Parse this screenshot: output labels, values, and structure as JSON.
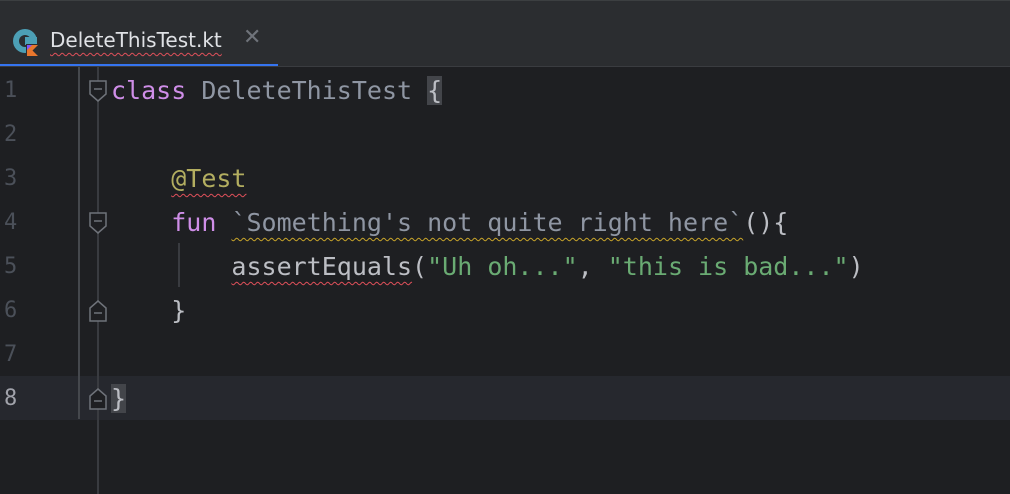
{
  "tab": {
    "title": "DeleteThisTest.kt",
    "close_glyph": "✕",
    "icon": "kotlin-class-file-icon",
    "accent": "#3574f0"
  },
  "editor": {
    "lines": [
      {
        "number": "1",
        "parts": [
          {
            "t": "class",
            "c": "kw"
          },
          {
            "t": " ",
            "c": "txt"
          },
          {
            "t": "DeleteThisTest",
            "c": "cls"
          },
          {
            "t": " ",
            "c": "txt"
          },
          {
            "t": "{",
            "c": "txt brace-hl"
          }
        ],
        "fold": "open"
      },
      {
        "number": "2",
        "parts": []
      },
      {
        "number": "3",
        "parts": [
          {
            "t": "    ",
            "c": "txt"
          },
          {
            "t": "@Test",
            "c": "ann squig-red"
          }
        ]
      },
      {
        "number": "4",
        "parts": [
          {
            "t": "    ",
            "c": "txt"
          },
          {
            "t": "fun",
            "c": "kw"
          },
          {
            "t": " ",
            "c": "txt"
          },
          {
            "t": "`Something's not quite right here`",
            "c": "cls squig-yellow"
          },
          {
            "t": "(){",
            "c": "txt"
          }
        ],
        "fold": "open"
      },
      {
        "number": "5",
        "parts": [
          {
            "t": "        ",
            "c": "txt"
          },
          {
            "t": "assertEquals",
            "c": "txt squig-red"
          },
          {
            "t": "(",
            "c": "txt"
          },
          {
            "t": "\"Uh oh...\"",
            "c": "str"
          },
          {
            "t": ", ",
            "c": "txt"
          },
          {
            "t": "\"this is bad...\"",
            "c": "str"
          },
          {
            "t": ")",
            "c": "txt"
          }
        ]
      },
      {
        "number": "6",
        "parts": [
          {
            "t": "    ",
            "c": "txt"
          },
          {
            "t": "}",
            "c": "txt"
          }
        ],
        "fold": "close"
      },
      {
        "number": "7",
        "parts": []
      },
      {
        "number": "8",
        "parts": [
          {
            "t": "}",
            "c": "txt brace-hl"
          }
        ],
        "fold": "close",
        "active": true
      }
    ],
    "colors": {
      "background": "#1e1f22",
      "keyword": "#cf8ee8",
      "string": "#6aab73",
      "annotation": "#b3ae60",
      "error_underline": "#e0505a",
      "warning_underline": "#c9a52a"
    }
  }
}
